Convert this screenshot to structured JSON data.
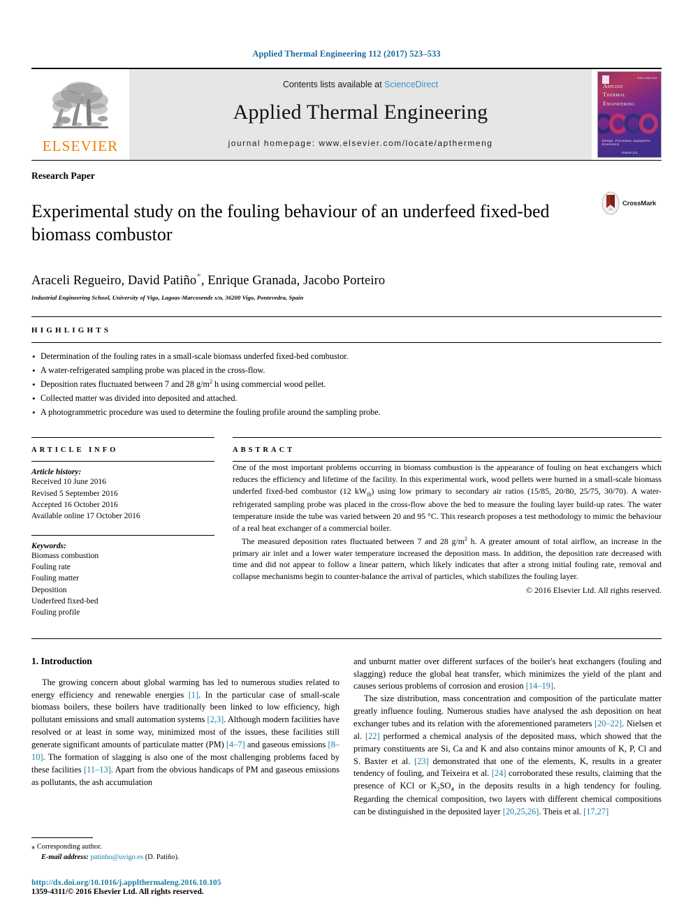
{
  "running_head": "Applied Thermal Engineering 112 (2017) 523–533",
  "masthead": {
    "publisher": "ELSEVIER",
    "contents_prefix": "Contents lists available at ",
    "contents_link": "ScienceDirect",
    "journal_title": "Applied Thermal Engineering",
    "homepage": "journal homepage: www.elsevier.com/locate/apthermeng",
    "cover": {
      "title_line1": "Applied",
      "title_line2": "Thermal",
      "title_line3": "Engineering",
      "footer_line": "Design, Processes, Equipment, Economics",
      "volume_line": "Volume 112",
      "issn": "ISSN 1359-4311"
    },
    "colors": {
      "link_blue": "#3a8fc4",
      "elsevier_orange": "#f07d00",
      "box_gray": "#e6e6e6"
    }
  },
  "article": {
    "paper_type": "Research Paper",
    "title": "Experimental study on the fouling behaviour of an underfeed fixed-bed biomass combustor",
    "crossmark_label": "CrossMark",
    "authors_part1": "Araceli Regueiro, David Patiño",
    "corresponding_mark": "*",
    "authors_part2": ", Enrique Granada, Jacobo Porteiro",
    "affiliation": "Industrial Engineering School, University of Vigo, Lagoas-Marcosende s/n, 36200 Vigo, Pontevedra, Spain"
  },
  "highlights": {
    "label": "HIGHLIGHTS",
    "items": [
      "Determination of the fouling rates in a small-scale biomass underfed fixed-bed combustor.",
      "A water-refrigerated sampling probe was placed in the cross-flow.",
      "Deposition rates fluctuated between 7 and 28 g/m2 h using commercial wood pellet.",
      "Collected matter was divided into deposited and attached.",
      "A photogrammetric procedure was used to determine the fouling profile around the sampling probe."
    ]
  },
  "article_info": {
    "label": "ARTICLE INFO",
    "history_heading": "Article history:",
    "history": [
      "Received 10 June 2016",
      "Revised 5 September 2016",
      "Accepted 16 October 2016",
      "Available online 17 October 2016"
    ],
    "keywords_heading": "Keywords:",
    "keywords": [
      "Biomass combustion",
      "Fouling rate",
      "Fouling matter",
      "Deposition",
      "Underfeed fixed-bed",
      "Fouling profile"
    ]
  },
  "abstract": {
    "label": "ABSTRACT",
    "paragraph1_a": "One of the most important problems occurring in biomass combustion is the appearance of fouling on heat exchangers which reduces the efficiency and lifetime of the facility. In this experimental work, wood pellets were burned in a small-scale biomass underfed fixed-bed combustor (12 kW",
    "paragraph1_sub": "th",
    "paragraph1_b": ") using low primary to secondary air ratios (15/85, 20/80, 25/75, 30/70). A water-refrigerated sampling probe was placed in the cross-flow above the bed to measure the fouling layer build-up rates. The water temperature inside the tube was varied between 20 and 95 °C. This research proposes a test methodology to mimic the behaviour of a real heat exchanger of a commercial boiler.",
    "paragraph2_a": "The measured deposition rates fluctuated between 7 and 28 g/m",
    "paragraph2_sup": "2",
    "paragraph2_b": " h. A greater amount of total airflow, an increase in the primary air inlet and a lower water temperature increased the deposition mass. In addition, the deposition rate decreased with time and did not appear to follow a linear pattern, which likely indicates that after a strong initial fouling rate, removal and collapse mechanisms begin to counter-balance the arrival of particles, which stabilizes the fouling layer.",
    "copyright": "© 2016 Elsevier Ltd. All rights reserved."
  },
  "body": {
    "section_heading": "1. Introduction",
    "left": {
      "p1_s1": "The growing concern about global warming has led to numerous studies related to energy efficiency and renewable energies ",
      "p1_c1": "[1]",
      "p1_s2": ". In the particular case of small-scale biomass boilers, these boilers have traditionally been linked to low efficiency, high pollutant emissions and small automation systems ",
      "p1_c2": "[2,3]",
      "p1_s3": ". Although modern facilities have resolved or at least in some way, minimized most of the issues, these facilities still generate significant amounts of particulate matter (PM) ",
      "p1_c3": "[4–7]",
      "p1_s4": " and gaseous emissions ",
      "p1_c4": "[8–10]",
      "p1_s5": ". The formation of slagging is also one of the most challenging problems faced by these facilities ",
      "p1_c5": "[11–13]",
      "p1_s6": ". Apart from the obvious handicaps of PM and gaseous emissions as pollutants, the ash accumulation"
    },
    "right": {
      "p1_cont": "and unburnt matter over different surfaces of the boiler's heat exchangers (fouling and slagging) reduce the global heat transfer, which minimizes the yield of the plant and causes serious problems of corrosion and erosion ",
      "p1_c6": "[14–19]",
      "p1_end": ".",
      "p2_s1": "The size distribution, mass concentration and composition of the particulate matter greatly influence fouling. Numerous studies have analysed the ash deposition on heat exchanger tubes and its relation with the aforementioned parameters ",
      "p2_c1": "[20–22]",
      "p2_s2": ". Nielsen et al. ",
      "p2_c2": "[22]",
      "p2_s3": " performed a chemical analysis of the deposited mass, which showed that the primary constituents are Si, Ca and K and also contains minor amounts of K, P, Cl and S. Baxter et al. ",
      "p2_c3": "[23]",
      "p2_s4": " demonstrated that one of the elements, K, results in a greater tendency of fouling, and Teixeira et al. ",
      "p2_c4": "[24]",
      "p2_s5": " corroborated these results, claiming that the presence of KCl or K",
      "p2_sub1": "2",
      "p2_s6": "SO",
      "p2_sub2": "4",
      "p2_s7": " in the deposits results in a high tendency for fouling. Regarding the chemical composition, two layers with different chemical compositions can be distinguished in the deposited layer ",
      "p2_c5": "[20,25,26]",
      "p2_s8": ". Theis et al. ",
      "p2_c6": "[17,27]"
    }
  },
  "footnote": {
    "corresponding_mark": "⁎",
    "corresponding_text": "Corresponding author.",
    "email_label": "E-mail address:",
    "email": "patinho@uvigo.es",
    "email_owner": "(D. Patiño)."
  },
  "footer": {
    "doi": "http://dx.doi.org/10.1016/j.applthermaleng.2016.10.105",
    "issn_line": "1359-4311/© 2016 Elsevier Ltd. All rights reserved."
  }
}
